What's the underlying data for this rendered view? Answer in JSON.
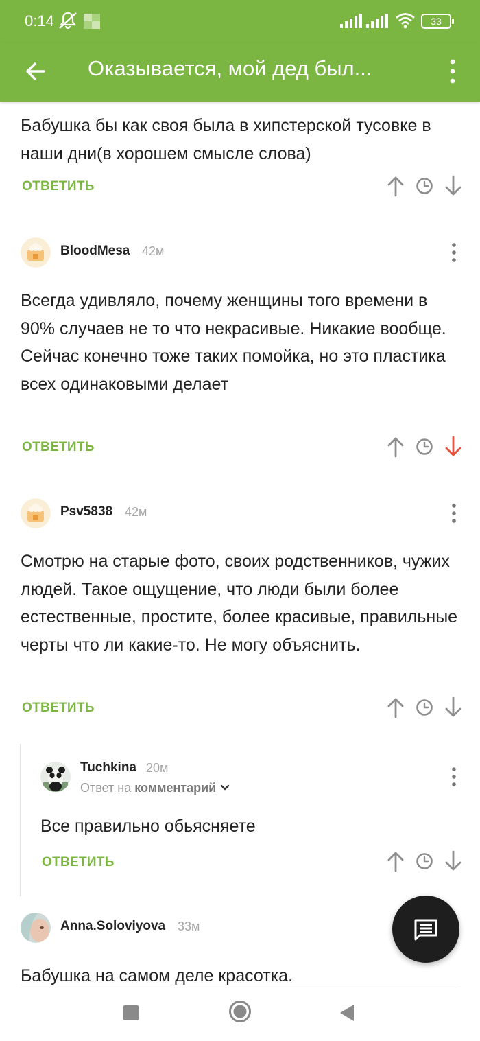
{
  "status_bar": {
    "time": "0:14",
    "battery": "33",
    "icons": [
      "mute-icon",
      "app-notification-icon",
      "signal-icon",
      "signal-icon",
      "wifi-icon",
      "battery-icon"
    ]
  },
  "app_bar": {
    "title": "Оказывается, мой дед был...",
    "back_icon": "arrow-left-icon",
    "menu_icon": "more-vertical-icon"
  },
  "comments": [
    {
      "text": "Бабушка бы как своя была в хипстерской тусовке в наши дни(в хорошем смысле слова)",
      "reply_label": "ОТВЕТИТЬ",
      "downvoted": false
    },
    {
      "author": "BloodMesa",
      "time": "42м",
      "text": "Всегда удивляло, почему женщины того времени в 90% случаев не то что некрасивые. Никакие вообще. Сейчас конечно тоже таких помойка, но это пластика всех одинаковыми делает",
      "reply_label": "ОТВЕТИТЬ",
      "downvoted": true
    },
    {
      "author": "Psv5838",
      "time": "42м",
      "text": "Смотрю на старые фото, своих родственников, чужих людей. Такое ощущение, что люди были более естественные, простите, более красивые, правильные черты что ли какие-то. Не могу объяснить.",
      "reply_label": "ОТВЕТИТЬ",
      "downvoted": false
    },
    {
      "author": "Tuchkina",
      "time": "20м",
      "reply_prefix": "Ответ на",
      "reply_target": "комментарий",
      "text": "Все правильно обьясняете",
      "reply_label": "ОТВЕТИТЬ",
      "downvoted": false
    },
    {
      "author": "Anna.Soloviyova",
      "time": "33м",
      "text": "Бабушка на самом деле красотка."
    }
  ],
  "fab": {
    "icon": "comment-icon"
  },
  "nav_bar": {
    "icons": [
      "recents-square-icon",
      "home-circle-icon",
      "back-triangle-icon"
    ]
  },
  "colors": {
    "accent": "#7cb642",
    "downvote_active": "#e5533d",
    "icon_gray": "#8e8e8e",
    "fab": "#1e1e1e"
  }
}
